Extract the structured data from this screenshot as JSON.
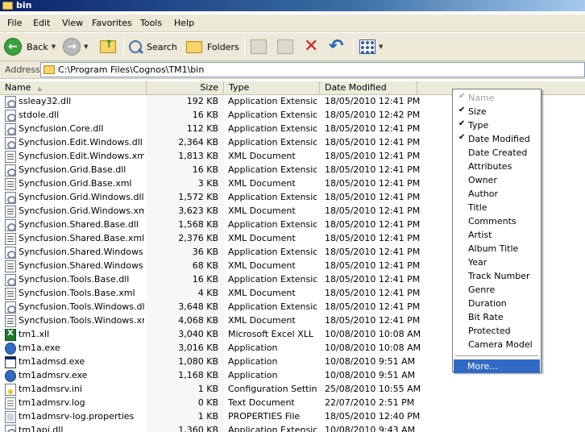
{
  "window": {
    "title": "bin"
  },
  "menu": [
    "File",
    "Edit",
    "View",
    "Favorites",
    "Tools",
    "Help"
  ],
  "toolbar": {
    "back_label": "Back",
    "search_label": "Search",
    "folders_label": "Folders",
    "icons": [
      "back-icon",
      "forward-icon",
      "up-folder-icon",
      "search-icon",
      "folders-icon",
      "move-to-icon",
      "copy-to-icon",
      "delete-icon",
      "undo-icon",
      "views-icon"
    ]
  },
  "address": {
    "label": "Address",
    "path": "C:\\Program Files\\Cognos\\TM1\\bin"
  },
  "columns": {
    "name": "Name",
    "size": "Size",
    "type": "Type",
    "date": "Date Modified"
  },
  "files": [
    {
      "name": "ssleay32.dll",
      "size": "192 KB",
      "type": "Application Extension",
      "date": "18/05/2010 12:41 PM",
      "icon": "dll"
    },
    {
      "name": "stdole.dll",
      "size": "16 KB",
      "type": "Application Extension",
      "date": "18/05/2010 12:42 PM",
      "icon": "dll"
    },
    {
      "name": "Syncfusion.Core.dll",
      "size": "112 KB",
      "type": "Application Extension",
      "date": "18/05/2010 12:41 PM",
      "icon": "dll"
    },
    {
      "name": "Syncfusion.Edit.Windows.dll",
      "size": "2,364 KB",
      "type": "Application Extension",
      "date": "18/05/2010 12:41 PM",
      "icon": "dll"
    },
    {
      "name": "Syncfusion.Edit.Windows.xml",
      "size": "1,813 KB",
      "type": "XML Document",
      "date": "18/05/2010 12:41 PM",
      "icon": "xml"
    },
    {
      "name": "Syncfusion.Grid.Base.dll",
      "size": "16 KB",
      "type": "Application Extension",
      "date": "18/05/2010 12:41 PM",
      "icon": "dll"
    },
    {
      "name": "Syncfusion.Grid.Base.xml",
      "size": "3 KB",
      "type": "XML Document",
      "date": "18/05/2010 12:41 PM",
      "icon": "xml"
    },
    {
      "name": "Syncfusion.Grid.Windows.dll",
      "size": "1,572 KB",
      "type": "Application Extension",
      "date": "18/05/2010 12:41 PM",
      "icon": "dll"
    },
    {
      "name": "Syncfusion.Grid.Windows.xml",
      "size": "3,623 KB",
      "type": "XML Document",
      "date": "18/05/2010 12:41 PM",
      "icon": "xml"
    },
    {
      "name": "Syncfusion.Shared.Base.dll",
      "size": "1,568 KB",
      "type": "Application Extension",
      "date": "18/05/2010 12:41 PM",
      "icon": "dll"
    },
    {
      "name": "Syncfusion.Shared.Base.xml",
      "size": "2,376 KB",
      "type": "XML Document",
      "date": "18/05/2010 12:41 PM",
      "icon": "xml"
    },
    {
      "name": "Syncfusion.Shared.Windows.dll",
      "size": "36 KB",
      "type": "Application Extension",
      "date": "18/05/2010 12:41 PM",
      "icon": "dll"
    },
    {
      "name": "Syncfusion.Shared.Windows....",
      "size": "68 KB",
      "type": "XML Document",
      "date": "18/05/2010 12:41 PM",
      "icon": "xml"
    },
    {
      "name": "Syncfusion.Tools.Base.dll",
      "size": "16 KB",
      "type": "Application Extension",
      "date": "18/05/2010 12:41 PM",
      "icon": "dll"
    },
    {
      "name": "Syncfusion.Tools.Base.xml",
      "size": "4 KB",
      "type": "XML Document",
      "date": "18/05/2010 12:41 PM",
      "icon": "xml"
    },
    {
      "name": "Syncfusion.Tools.Windows.dll",
      "size": "3,648 KB",
      "type": "Application Extension",
      "date": "18/05/2010 12:41 PM",
      "icon": "dll"
    },
    {
      "name": "Syncfusion.Tools.Windows.xml",
      "size": "4,068 KB",
      "type": "XML Document",
      "date": "18/05/2010 12:41 PM",
      "icon": "xml"
    },
    {
      "name": "tm1.xll",
      "size": "3,040 KB",
      "type": "Microsoft Excel XLL ...",
      "date": "10/08/2010 10:08 AM",
      "icon": "xll"
    },
    {
      "name": "tm1a.exe",
      "size": "3,016 KB",
      "type": "Application",
      "date": "10/08/2010 10:08 AM",
      "icon": "exe"
    },
    {
      "name": "tm1admsd.exe",
      "size": "1,080 KB",
      "type": "Application",
      "date": "10/08/2010 9:51 AM",
      "icon": "app"
    },
    {
      "name": "tm1admsrv.exe",
      "size": "1,168 KB",
      "type": "Application",
      "date": "10/08/2010 9:51 AM",
      "icon": "exe"
    },
    {
      "name": "tm1admsrv.ini",
      "size": "1 KB",
      "type": "Configuration Settings",
      "date": "25/08/2010 10:55 AM",
      "icon": "ini"
    },
    {
      "name": "tm1admsrv.log",
      "size": "0 KB",
      "type": "Text Document",
      "date": "22/07/2010 2:51 PM",
      "icon": "log"
    },
    {
      "name": "tm1admsrv-log.properties",
      "size": "1 KB",
      "type": "PROPERTIES File",
      "date": "18/05/2010 12:40 PM",
      "icon": "prop"
    },
    {
      "name": "tm1api.dll",
      "size": "1,360 KB",
      "type": "Application Extension",
      "date": "10/08/2010 9:43 AM",
      "icon": "dll"
    }
  ],
  "context_menu": {
    "items": [
      {
        "label": "Name",
        "checked": true,
        "disabled": true
      },
      {
        "label": "Size",
        "checked": true,
        "disabled": false
      },
      {
        "label": "Type",
        "checked": true,
        "disabled": false
      },
      {
        "label": "Date Modified",
        "checked": true,
        "disabled": false
      },
      {
        "label": "Date Created",
        "checked": false,
        "disabled": false
      },
      {
        "label": "Attributes",
        "checked": false,
        "disabled": false
      },
      {
        "label": "Owner",
        "checked": false,
        "disabled": false
      },
      {
        "label": "Author",
        "checked": false,
        "disabled": false
      },
      {
        "label": "Title",
        "checked": false,
        "disabled": false
      },
      {
        "label": "Comments",
        "checked": false,
        "disabled": false
      },
      {
        "label": "Artist",
        "checked": false,
        "disabled": false
      },
      {
        "label": "Album Title",
        "checked": false,
        "disabled": false
      },
      {
        "label": "Year",
        "checked": false,
        "disabled": false
      },
      {
        "label": "Track Number",
        "checked": false,
        "disabled": false
      },
      {
        "label": "Genre",
        "checked": false,
        "disabled": false
      },
      {
        "label": "Duration",
        "checked": false,
        "disabled": false
      },
      {
        "label": "Bit Rate",
        "checked": false,
        "disabled": false
      },
      {
        "label": "Protected",
        "checked": false,
        "disabled": false
      },
      {
        "label": "Camera Model",
        "checked": false,
        "disabled": false
      }
    ],
    "more_label": "More..."
  }
}
